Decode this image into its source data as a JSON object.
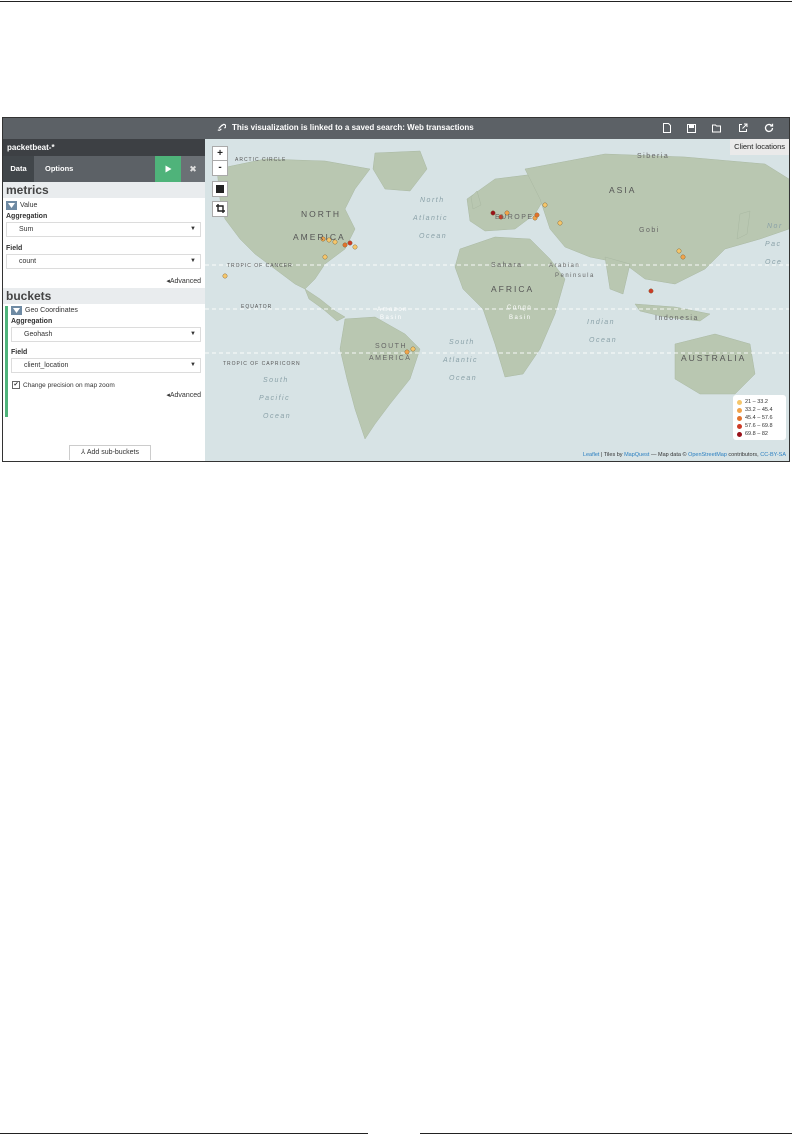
{
  "topbar": {
    "link_message": "This visualization is linked to a saved search: Web transactions",
    "icons": [
      "new-icon",
      "save-icon",
      "open-icon",
      "share-icon",
      "refresh-icon"
    ]
  },
  "sidebar": {
    "index_pattern": "packetbeat-*",
    "tabs": [
      "Data",
      "Options"
    ],
    "metrics": {
      "heading": "metrics",
      "agg_name": "Value",
      "aggregation_label": "Aggregation",
      "aggregation_value": "Sum",
      "field_label": "Field",
      "field_value": "count",
      "advanced": "Advanced"
    },
    "buckets": {
      "heading": "buckets",
      "agg_name": "Geo Coordinates",
      "aggregation_label": "Aggregation",
      "aggregation_value": "Geohash",
      "field_label": "Field",
      "field_value": "client_location",
      "precision_label": "Change precision on map zoom",
      "advanced": "Advanced",
      "add_sub_buckets": "Add sub-buckets"
    }
  },
  "map": {
    "title": "Client locations",
    "zoom_in": "+",
    "zoom_out": "-",
    "labels": {
      "arctic_circle": "ARCTIC CIRCLE",
      "siberia": "Siberia",
      "north_america_1": "NORTH",
      "north_america_2": "AMERICA",
      "north_atlantic_1": "North",
      "north_atlantic_2": "Atlantic",
      "north_atlantic_3": "Ocean",
      "europe": "EUROPE",
      "asia": "ASIA",
      "gobi": "Gobi",
      "tropic_cancer": "TROPIC OF CANCER",
      "sahara": "Sahara",
      "arabian_1": "Arabian",
      "arabian_2": "Peninsula",
      "africa": "AFRICA",
      "equator": "EQUATOR",
      "amazon_1": "Amazon",
      "amazon_2": "Basin",
      "congo_1": "Congo",
      "congo_2": "Basin",
      "indian_1": "Indian",
      "indian_2": "Ocean",
      "indonesia": "Indonesia",
      "tropic_capricorn": "TROPIC OF CAPRICORN",
      "south_america_1": "SOUTH",
      "south_america_2": "AMERICA",
      "south_atlantic_1": "South",
      "south_atlantic_2": "Atlantic",
      "south_atlantic_3": "Ocean",
      "australia": "AUSTRALIA",
      "south_pacific_1": "South",
      "south_pacific_2": "Pacific",
      "south_pacific_3": "Ocean",
      "north_pacific_1": "Nor",
      "north_pacific_2": "Pac",
      "north_pacific_3": "Oce"
    },
    "legend": [
      {
        "range": "21 – 33.2",
        "color": "#f5c66b"
      },
      {
        "range": "33.2 – 45.4",
        "color": "#f0a34a"
      },
      {
        "range": "45.4 – 57.6",
        "color": "#e2722c"
      },
      {
        "range": "57.6 – 69.8",
        "color": "#cc3b27"
      },
      {
        "range": "69.8 – 82",
        "color": "#99121a"
      }
    ],
    "attribution": {
      "leaflet": "Leaflet",
      "tiles_text": " | Tiles by ",
      "mapquest": "MapQuest",
      "data_text": " — Map data © ",
      "osm": "OpenStreetMap",
      "contrib_text": " contributors, ",
      "license": "CC-BY-SA"
    },
    "colors": {
      "land": "#b9c7b1",
      "ocean": "#d7e3e5",
      "accent": "#4fb37a"
    }
  }
}
